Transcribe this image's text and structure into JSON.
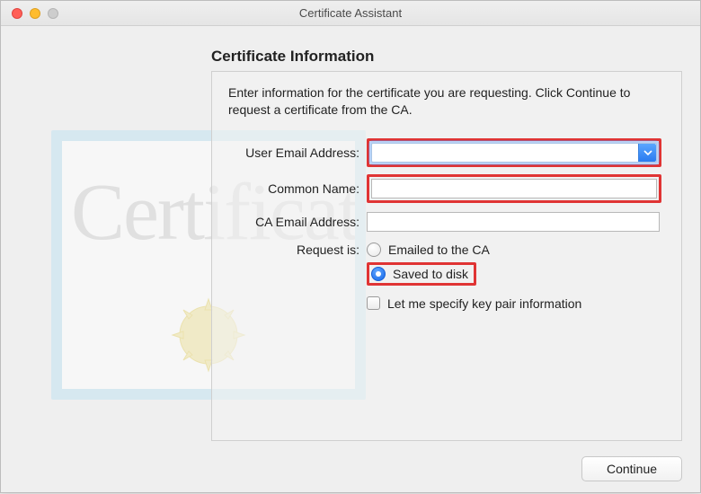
{
  "window_title": "Certificate Assistant",
  "heading": "Certificate Information",
  "instructions": "Enter information for the certificate you are requesting. Click Continue to request a certificate from the CA.",
  "fields": {
    "user_email": {
      "label": "User Email Address:",
      "value": ""
    },
    "common_name": {
      "label": "Common Name:",
      "value": ""
    },
    "ca_email": {
      "label": "CA Email Address:",
      "value": ""
    }
  },
  "request": {
    "label": "Request is:",
    "options": {
      "emailed": "Emailed to the CA",
      "saved": "Saved to disk"
    },
    "selected": "saved"
  },
  "keypair_checkbox": {
    "label": "Let me specify key pair information",
    "checked": false
  },
  "continue_label": "Continue",
  "background_art_text": "Certificate"
}
